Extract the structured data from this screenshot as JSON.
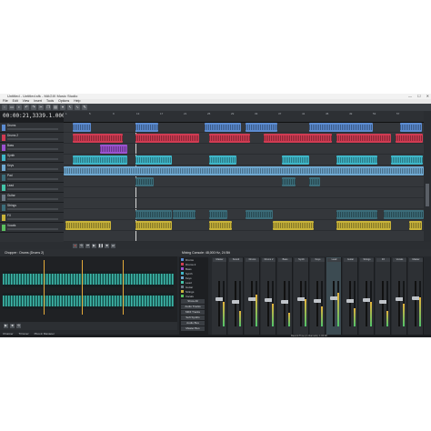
{
  "window": {
    "title": "Untitled - Untitled.sfk  - MAGIX Music Studio",
    "min": "—",
    "max": "☐",
    "close": "✕"
  },
  "menu": [
    "File",
    "Edit",
    "View",
    "Insert",
    "Tools",
    "Options",
    "Help"
  ],
  "transport": {
    "time": "00:00:21,333",
    "measure": "9.1.000"
  },
  "ruler_marks": [
    "1",
    "5",
    "9",
    "13",
    "17",
    "21",
    "25",
    "29",
    "33",
    "37",
    "41",
    "45",
    "49",
    "53",
    "57"
  ],
  "tracks": [
    {
      "name": "Drums",
      "color": "#5b8bd0",
      "volume": "0.0 dB"
    },
    {
      "name": "Drums 2",
      "color": "#d03b52",
      "volume": "0.0 dB"
    },
    {
      "name": "Bass",
      "color": "#9b52d0",
      "volume": "0.0 dB"
    },
    {
      "name": "Synth",
      "color": "#3fb6c8",
      "volume": "0.0 dB"
    },
    {
      "name": "Keys",
      "color": "#6fa8d0",
      "volume": "0.0 dB"
    },
    {
      "name": "Pad",
      "color": "#3c6d7a",
      "volume": "0.0 dB"
    },
    {
      "name": "Lead",
      "color": "#44c4a8",
      "volume": "0.0 dB"
    },
    {
      "name": "Guitar",
      "color": "#6b7884",
      "volume": "0.0 dB"
    },
    {
      "name": "Strings",
      "color": "#3c6d7a",
      "volume": "0.0 dB"
    },
    {
      "name": "FX",
      "color": "#c8b33a",
      "volume": "0.0 dB"
    },
    {
      "name": "Vocals",
      "color": "#5bbf5f",
      "volume": "0.0 dB"
    }
  ],
  "trimmer": {
    "title": "Chopper : Drums (Drums 2)"
  },
  "trimmer_tabs": [
    "Chopper",
    "Trimmer",
    "Plug-In Manager"
  ],
  "mixer": {
    "title": "Mixing Console: 48,000 Hz, 24 Bit",
    "list": [
      {
        "name": "Drums",
        "color": "#5b8bd0"
      },
      {
        "name": "Drums 2",
        "color": "#d03b52"
      },
      {
        "name": "Bass",
        "color": "#9b52d0"
      },
      {
        "name": "Synth",
        "color": "#3fb6c8"
      },
      {
        "name": "Keys",
        "color": "#6fa8d0"
      },
      {
        "name": "Lead",
        "color": "#44c4a8"
      },
      {
        "name": "Guitar",
        "color": "#6b7884"
      },
      {
        "name": "Strings",
        "color": "#c8b33a"
      },
      {
        "name": "Vocals",
        "color": "#5bbf5f"
      }
    ],
    "buttons": [
      "Show All",
      "Audio Tracks",
      "MIDI Tracks",
      "Soft Synths",
      "Audio Bus",
      "Master Bus"
    ],
    "strips": [
      {
        "label": "Master",
        "level": 0.55,
        "fader": 0.4
      },
      {
        "label": "Sound",
        "level": 0.35,
        "fader": 0.45
      },
      {
        "label": "Drums",
        "level": 0.7,
        "fader": 0.4
      },
      {
        "label": "Drums 2",
        "level": 0.5,
        "fader": 0.42
      },
      {
        "label": "Bass",
        "level": 0.3,
        "fader": 0.45
      },
      {
        "label": "Synth",
        "level": 0.6,
        "fader": 0.4
      },
      {
        "label": "Keys",
        "level": 0.45,
        "fader": 0.43
      },
      {
        "label": "Lead",
        "level": 0.75,
        "fader": 0.38
      },
      {
        "label": "Guitar",
        "level": 0.4,
        "fader": 0.44
      },
      {
        "label": "Strings",
        "level": 0.55,
        "fader": 0.41
      },
      {
        "label": "FX",
        "level": 0.35,
        "fader": 0.46
      },
      {
        "label": "Vocals",
        "level": 0.5,
        "fader": 0.4
      },
      {
        "label": "Master",
        "level": 0.65,
        "fader": 0.36
      }
    ]
  },
  "status": "Record Time (2 channels): 1:00:00"
}
